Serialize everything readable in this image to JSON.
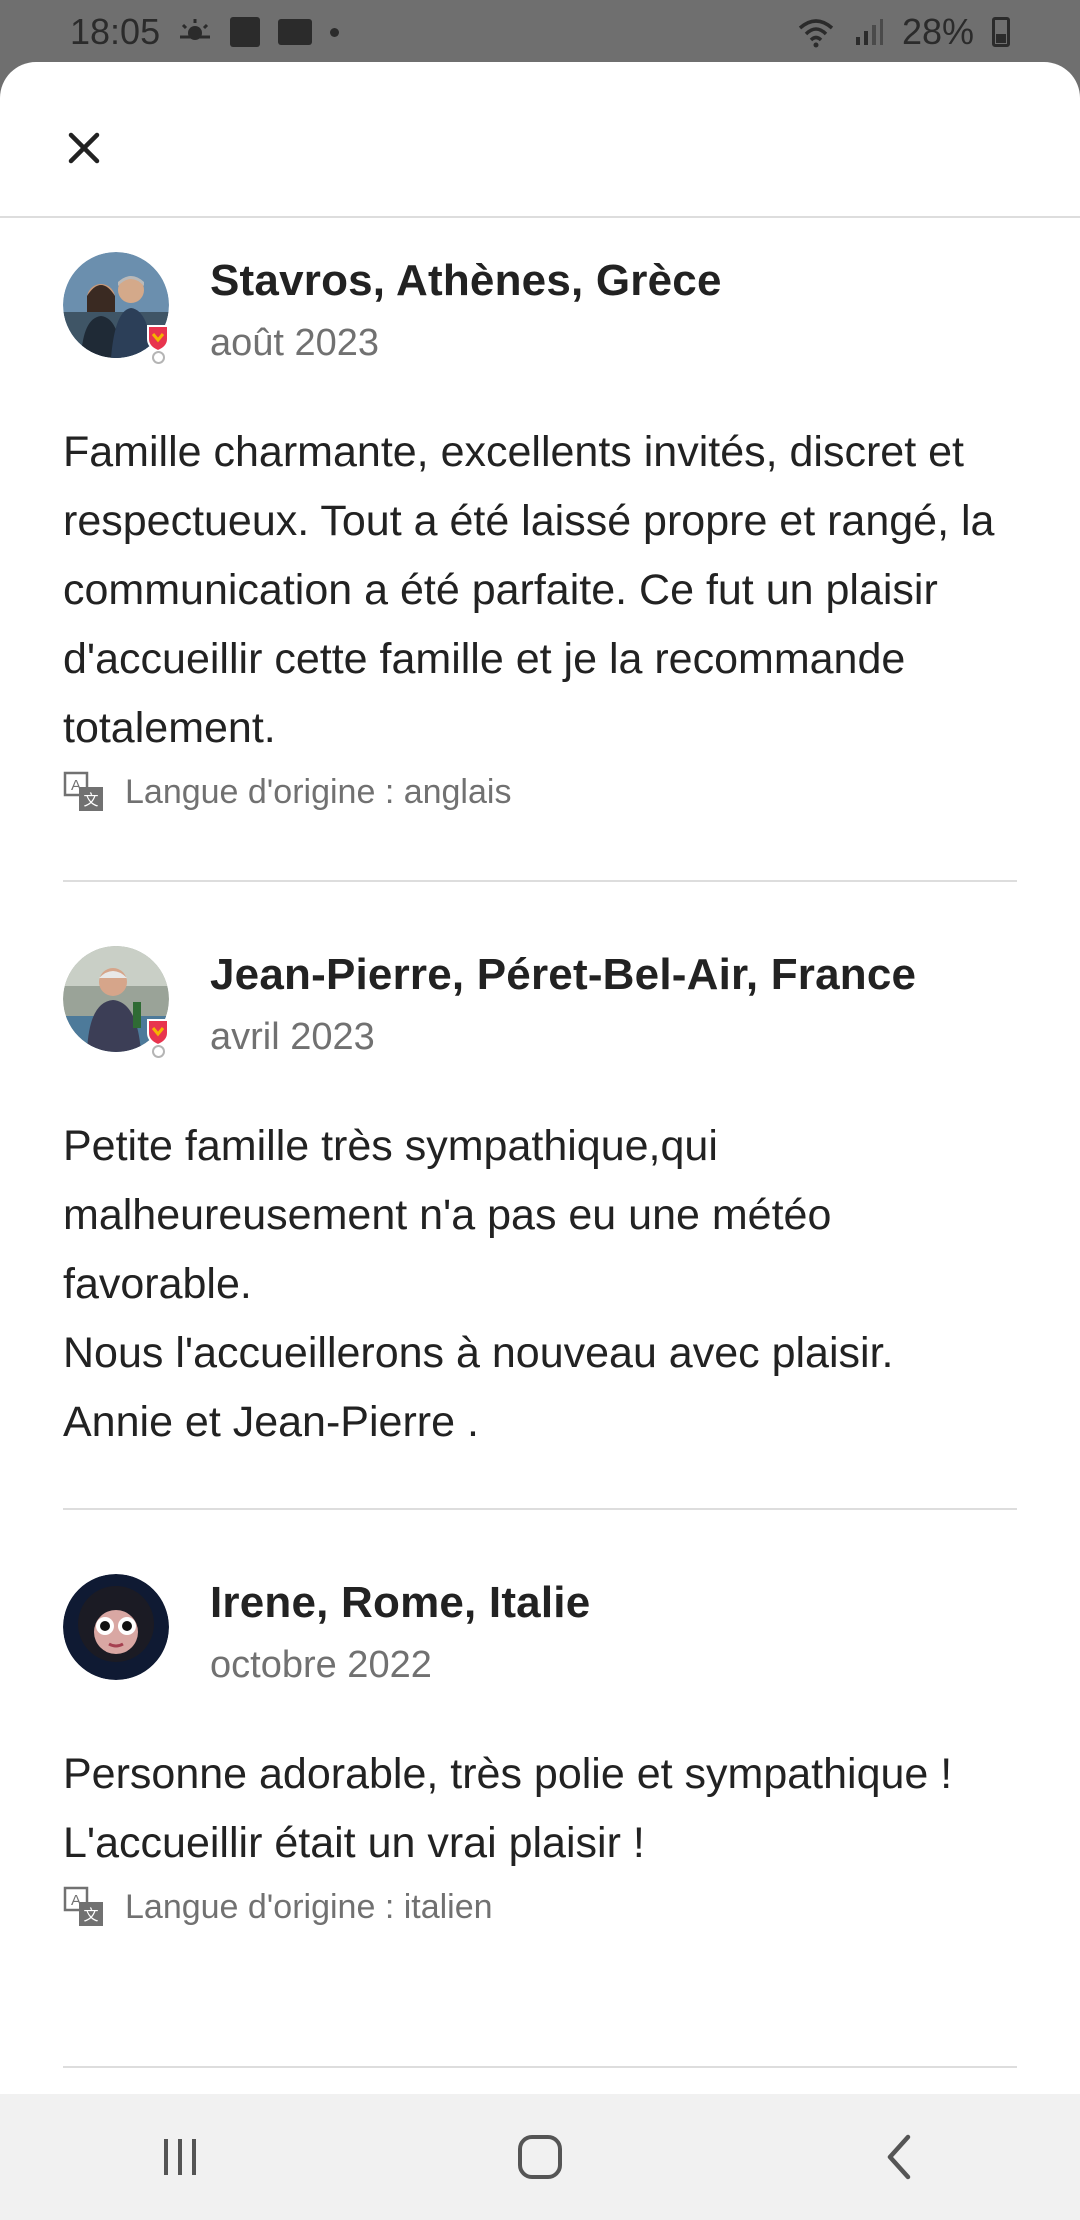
{
  "status_bar": {
    "time": "18:05",
    "battery_percent": "28%",
    "left_icons": [
      "sun-cloud-icon",
      "app-square-icon",
      "folder-icon",
      "dot-icon"
    ],
    "right_icons": [
      "wifi-icon",
      "signal-icon",
      "battery-icon"
    ]
  },
  "header": {
    "close_icon": "close-icon"
  },
  "reviews": [
    {
      "name": "Stavros, Athènes, Grèce",
      "date": "août 2023",
      "text": "Famille charmante, excellents invités, discret et respectueux. Tout a été laissé propre et rangé, la communication a été parfaite. Ce fut un plaisir d'accueillir cette famille et je la recommande totalement.",
      "language_note": "Langue d'origine : anglais",
      "superhost_badge": true
    },
    {
      "name": "Jean-Pierre, Péret-Bel-Air, France",
      "date": "avril 2023",
      "text": "Petite famille très sympathique,qui malheureusement n'a pas eu une météo favorable.\nNous l'accueillerons à nouveau avec plaisir.\nAnnie et Jean-Pierre .",
      "superhost_badge": true
    },
    {
      "name": "Irene, Rome, Italie",
      "date": "octobre 2022",
      "text": "Personne adorable, très polie et sympathique !\nL'accueillir était un vrai plaisir !",
      "language_note": "Langue d'origine : italien",
      "superhost_badge": false
    }
  ],
  "nav_bar": {
    "buttons": [
      "recent-apps-icon",
      "home-icon",
      "back-icon"
    ]
  },
  "colors": {
    "primary_text": "#222222",
    "secondary_text": "#717171",
    "divider": "#dddddd",
    "badge": "#e8344e"
  }
}
